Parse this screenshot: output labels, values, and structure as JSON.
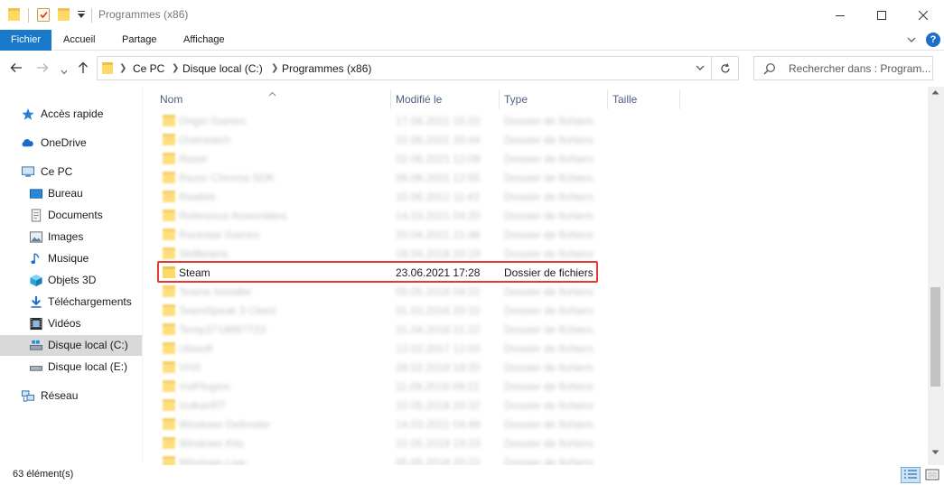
{
  "window": {
    "title": "Programmes (x86)"
  },
  "ribbon": {
    "tabs": [
      "Fichier",
      "Accueil",
      "Partage",
      "Affichage"
    ],
    "help": "?"
  },
  "address": {
    "crumbs": [
      "Ce PC",
      "Disque local (C:)",
      "Programmes (x86)"
    ]
  },
  "search": {
    "placeholder": "Rechercher dans : Program..."
  },
  "sidebar": {
    "items": [
      {
        "label": "Accès rapide",
        "icon": "star-icon"
      },
      {
        "label": "OneDrive",
        "icon": "cloud-icon"
      },
      {
        "label": "Ce PC",
        "icon": "computer-icon"
      },
      {
        "label": "Bureau",
        "icon": "desktop-icon"
      },
      {
        "label": "Documents",
        "icon": "documents-icon"
      },
      {
        "label": "Images",
        "icon": "images-icon"
      },
      {
        "label": "Musique",
        "icon": "music-icon"
      },
      {
        "label": "Objets 3D",
        "icon": "cube-icon"
      },
      {
        "label": "Téléchargements",
        "icon": "download-icon"
      },
      {
        "label": "Vidéos",
        "icon": "video-icon"
      },
      {
        "label": "Disque local (C:)",
        "icon": "drive-icon"
      },
      {
        "label": "Disque local (E:)",
        "icon": "drive-icon"
      },
      {
        "label": "Réseau",
        "icon": "network-icon"
      }
    ],
    "selected": "Disque local (C:)"
  },
  "columns": {
    "name": "Nom",
    "modified": "Modifié le",
    "type": "Type",
    "size": "Taille"
  },
  "files": [
    {
      "name": "Origin Games",
      "date": "17.06.2021 15:22",
      "type": "Dossier de fichiers",
      "blurred": true
    },
    {
      "name": "Overwatch",
      "date": "22.06.2021 20:44",
      "type": "Dossier de fichiers",
      "blurred": true
    },
    {
      "name": "Razer",
      "date": "02.06.2021 12:09",
      "type": "Dossier de fichiers",
      "blurred": true
    },
    {
      "name": "Razer Chroma SDK",
      "date": "08.06.2021 12:55",
      "type": "Dossier de fichiers",
      "blurred": true
    },
    {
      "name": "Realtek",
      "date": "15.06.2012 11:43",
      "type": "Dossier de fichiers",
      "blurred": true
    },
    {
      "name": "Reference Assemblies",
      "date": "14.03.2021 04:20",
      "type": "Dossier de fichiers",
      "blurred": true
    },
    {
      "name": "Rockstar Games",
      "date": "20.04.2021 21:48",
      "type": "Dossier de fichiers",
      "blurred": true
    },
    {
      "name": "Skillbrains",
      "date": "18.04.2018 20:19",
      "type": "Dossier de fichiers",
      "blurred": true
    },
    {
      "name": "Steam",
      "date": "23.06.2021 17:28",
      "type": "Dossier de fichiers",
      "blurred": false
    },
    {
      "name": "Teams Installer",
      "date": "05.05.2018 04:22",
      "type": "Dossier de fichiers",
      "blurred": true
    },
    {
      "name": "TeamSpeak 3 Client",
      "date": "01.03.2016 20:32",
      "type": "Dossier de fichiers",
      "blurred": true
    },
    {
      "name": "Temp3719897723",
      "date": "21.04.2018 21:22",
      "type": "Dossier de fichiers",
      "blurred": true
    },
    {
      "name": "Ubisoft",
      "date": "12.02.2017 12:03",
      "type": "Dossier de fichiers",
      "blurred": true
    },
    {
      "name": "VHX",
      "date": "28.02.2019 18:20",
      "type": "Dossier de fichiers",
      "blurred": true
    },
    {
      "name": "VstPlugins",
      "date": "11.09.2018 09:22",
      "type": "Dossier de fichiers",
      "blurred": true
    },
    {
      "name": "VulkanRT",
      "date": "10.05.2018 20:32",
      "type": "Dossier de fichiers",
      "blurred": true
    },
    {
      "name": "Windows Defender",
      "date": "14.03.2021 04:49",
      "type": "Dossier de fichiers",
      "blurred": true
    },
    {
      "name": "Windows Kits",
      "date": "22.05.2019 19:23",
      "type": "Dossier de fichiers",
      "blurred": true
    },
    {
      "name": "Windows Live",
      "date": "05.05.2018 20:22",
      "type": "Dossier de fichiers",
      "blurred": true
    }
  ],
  "status": {
    "count": "63 élément(s)"
  }
}
